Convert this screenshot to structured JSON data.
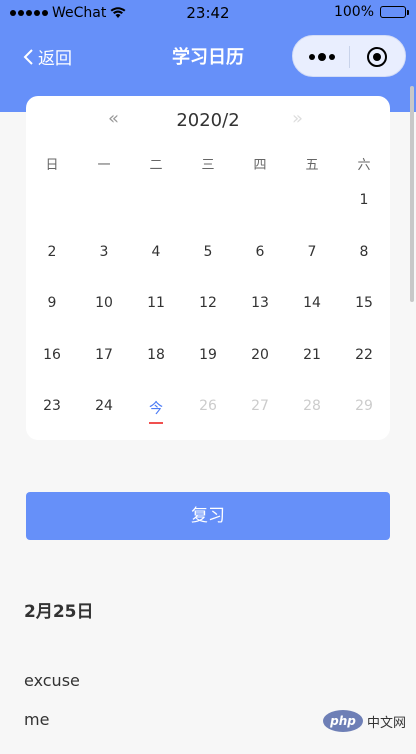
{
  "status_bar": {
    "carrier": "WeChat",
    "time": "23:42",
    "battery": "100%",
    "battery_level": 1.0
  },
  "nav": {
    "back_label": "返回",
    "title": "学习日历"
  },
  "calendar": {
    "prev_icon": "«",
    "next_icon": "»",
    "month": "2020/2",
    "weekdays": [
      "日",
      "一",
      "二",
      "三",
      "四",
      "五",
      "六"
    ],
    "days": [
      "",
      "",
      "",
      "",
      "",
      "",
      "1",
      "2",
      "3",
      "4",
      "5",
      "6",
      "7",
      "8",
      "9",
      "10",
      "11",
      "12",
      "13",
      "14",
      "15",
      "16",
      "17",
      "18",
      "19",
      "20",
      "21",
      "22",
      "23",
      "24",
      "今",
      "26",
      "27",
      "28",
      "29"
    ],
    "today_index": 30,
    "disabled_from_index": 31,
    "today_color": "#4d7cf5",
    "today_marker_color": "#f0504f"
  },
  "review_button": "复习",
  "selected_date": "2月25日",
  "words": [
    "excuse",
    "me"
  ],
  "watermark": {
    "logo": "php",
    "text": "中文网"
  },
  "colors": {
    "primary": "#6690f9",
    "background": "#f7f7f7"
  }
}
